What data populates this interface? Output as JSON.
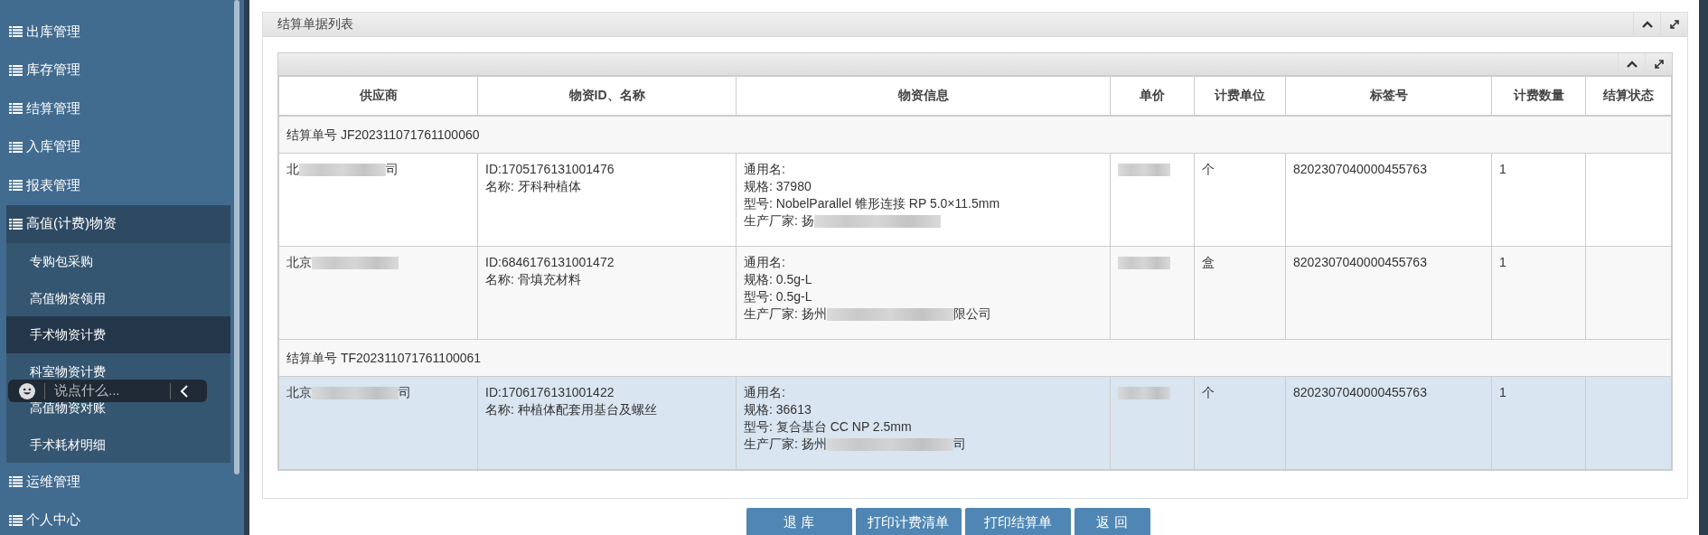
{
  "sidebar": {
    "items": [
      {
        "label": "出库管理",
        "expanded": false
      },
      {
        "label": "库存管理",
        "expanded": false
      },
      {
        "label": "结算管理",
        "expanded": false
      },
      {
        "label": "入库管理",
        "expanded": false
      },
      {
        "label": "报表管理",
        "expanded": false
      },
      {
        "label": "高值(计费)物资",
        "expanded": true,
        "children": [
          {
            "label": "专购包采购",
            "selected": false
          },
          {
            "label": "高值物资领用",
            "selected": false
          },
          {
            "label": "手术物资计费",
            "selected": true
          },
          {
            "label": "科室物资计费",
            "selected": false
          },
          {
            "label": "高值物资对账",
            "selected": false
          },
          {
            "label": "手术耗材明细",
            "selected": false
          }
        ]
      },
      {
        "label": "运维管理",
        "expanded": false
      },
      {
        "label": "个人中心",
        "expanded": false
      }
    ]
  },
  "chat_widget": {
    "placeholder": "说点什么..."
  },
  "panel": {
    "title": "结算单据列表"
  },
  "table": {
    "columns": [
      "供应商",
      "物资ID、名称",
      "物资信息",
      "单价",
      "计费单位",
      "标签号",
      "计费数量",
      "结算状态"
    ],
    "groups": [
      {
        "number": "结算单号 JF202311071761100060",
        "rows": [
          {
            "selected": false,
            "supplier": {
              "start": "北",
              "end": "司"
            },
            "item_id": "ID:1705176131001476",
            "item_name": "名称: 牙科种植体",
            "info": [
              "通用名:",
              "规格: 37980",
              "型号: NobelParallel 锥形连接 RP 5.0×11.5mm"
            ],
            "maker": {
              "start": "生产厂家: 扬"
            },
            "unit": "个",
            "tag": "8202307040000455763",
            "qty": "1"
          },
          {
            "selected": false,
            "supplier": {
              "start": "北京"
            },
            "item_id": "ID:6846176131001472",
            "item_name": "名称: 骨填充材料",
            "info": [
              "通用名:",
              "规格: 0.5g-L",
              "型号: 0.5g-L"
            ],
            "maker": {
              "start": "生产厂家: 扬州",
              "end": "限公司"
            },
            "unit": "盒",
            "tag": "8202307040000455763",
            "qty": "1"
          }
        ]
      },
      {
        "number": "结算单号 TF202311071761100061",
        "rows": [
          {
            "selected": true,
            "supplier": {
              "start": "北京",
              "end": "司"
            },
            "item_id": "ID:1706176131001422",
            "item_name": "名称: 种植体配套用基台及螺丝",
            "info": [
              "通用名:",
              "规格: 36613",
              "型号: 复合基台 CC NP 2.5mm"
            ],
            "maker": {
              "start": "生产厂家: 扬州",
              "end": "司"
            },
            "unit": "个",
            "tag": "8202307040000455763",
            "qty": "1"
          }
        ]
      }
    ]
  },
  "buttons": [
    "退 库",
    "打印计费清单",
    "打印结算单",
    "返 回"
  ]
}
